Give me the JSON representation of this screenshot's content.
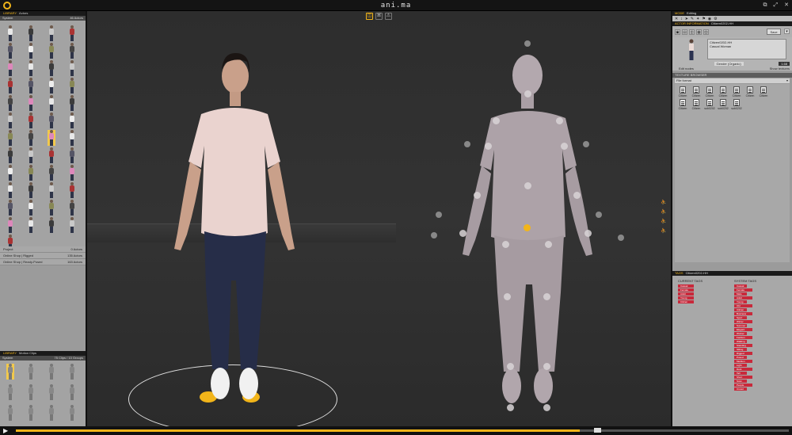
{
  "app": {
    "title": "ani.ma"
  },
  "window": {
    "controls": [
      "⧉",
      "⤢",
      "✕"
    ]
  },
  "viewport": {
    "tools": [
      {
        "name": "render-mode-icon",
        "glyph": "◫"
      },
      {
        "name": "skeleton-icon",
        "glyph": "ꕤ"
      },
      {
        "name": "warning-icon",
        "glyph": "⚠"
      }
    ]
  },
  "left_panel": {
    "library_label": "LIBRARY",
    "library_value": "Actors",
    "system_label": "System",
    "system_count": "46 Actors",
    "sections": [
      {
        "label": "Project",
        "count": "0 Actors"
      },
      {
        "label": "Online Shop | Rigged",
        "count": "135 Actors"
      },
      {
        "label": "Online Shop | Ready-Posed",
        "count": "163 Actors"
      }
    ],
    "library2_label": "LIBRARY",
    "library2_value": "Motion Clips",
    "system2_label": "System",
    "system2_count": "75 Clips / 13 Groups"
  },
  "right_panel": {
    "mode_label": "MODE",
    "mode_value": "Editing",
    "actor_info_label": "ACTOR INFORMATION",
    "actor_info_value": "Citizen0202-HH",
    "save_label": "Save",
    "actor_name": "Citizen0202-HH",
    "actor_desc": "Casual Woman",
    "gender": "Gender (Organic)",
    "height": "1.68",
    "edit_nodes": "Edit nodes",
    "show_textures": "Show textures",
    "texture_browser_label": "TEXTURE BROWSER",
    "file_format": "File format",
    "textures": [
      "Citizen",
      "Citizen",
      "Citizen",
      "Citizen",
      "Citizen",
      "Citizen",
      "Citizen",
      "Citizen",
      "Citizen",
      "sub0202",
      "sub0202",
      "sub0202"
    ],
    "tags_label": "TAGS",
    "tags_value": "Citizen0202-HH",
    "current_tags_label": "CURRENT TAGS",
    "system_tags_label": "SYSTEM TAGS",
    "current_tags": [
      "Casual",
      "Female",
      "Adult",
      "Young",
      "Citizen"
    ],
    "system_tags": [
      "Casual",
      "Female",
      "Male",
      "Adult",
      "Young",
      "Old",
      "Citizen",
      "Business",
      "Sport",
      "Winter",
      "Summer",
      "Elegant",
      "Worker",
      "Fashion",
      "Walking",
      "Standing",
      "Sitting",
      "Rigged",
      "Posed",
      "Medium",
      "Light",
      "Dark",
      "Tall",
      "Short",
      "Scan",
      "People",
      "Crowd"
    ]
  },
  "timeline": {
    "play_icon": "▶",
    "progress": 0.73
  },
  "colors": {
    "accent": "#f2b51a",
    "tag": "#c8293b"
  }
}
